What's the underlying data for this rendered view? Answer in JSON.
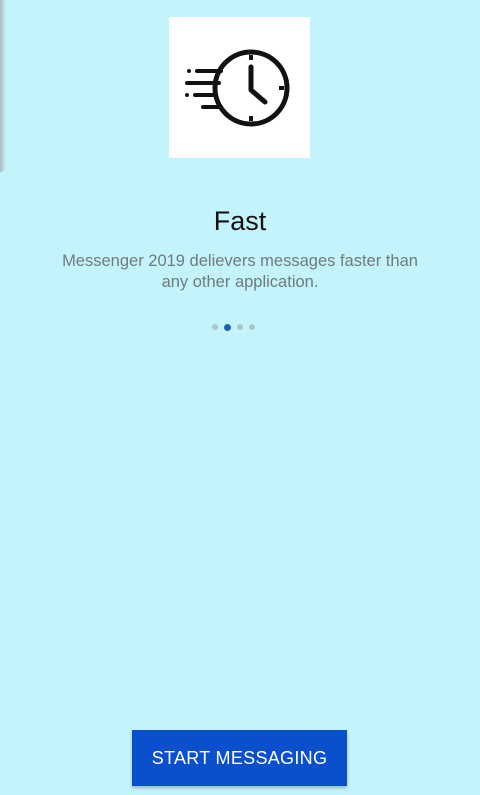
{
  "onboarding": {
    "hero_icon": "fast-clock-icon",
    "title": "Fast",
    "subtitle": "Messenger 2019 delievers messages faster than any other application.",
    "page_count": 4,
    "active_page": 2
  },
  "actions": {
    "start_label": "START MESSAGING"
  },
  "colors": {
    "background": "#c4f4fb",
    "button": "#0a4fcc",
    "active_dot": "#1f5fb8"
  }
}
